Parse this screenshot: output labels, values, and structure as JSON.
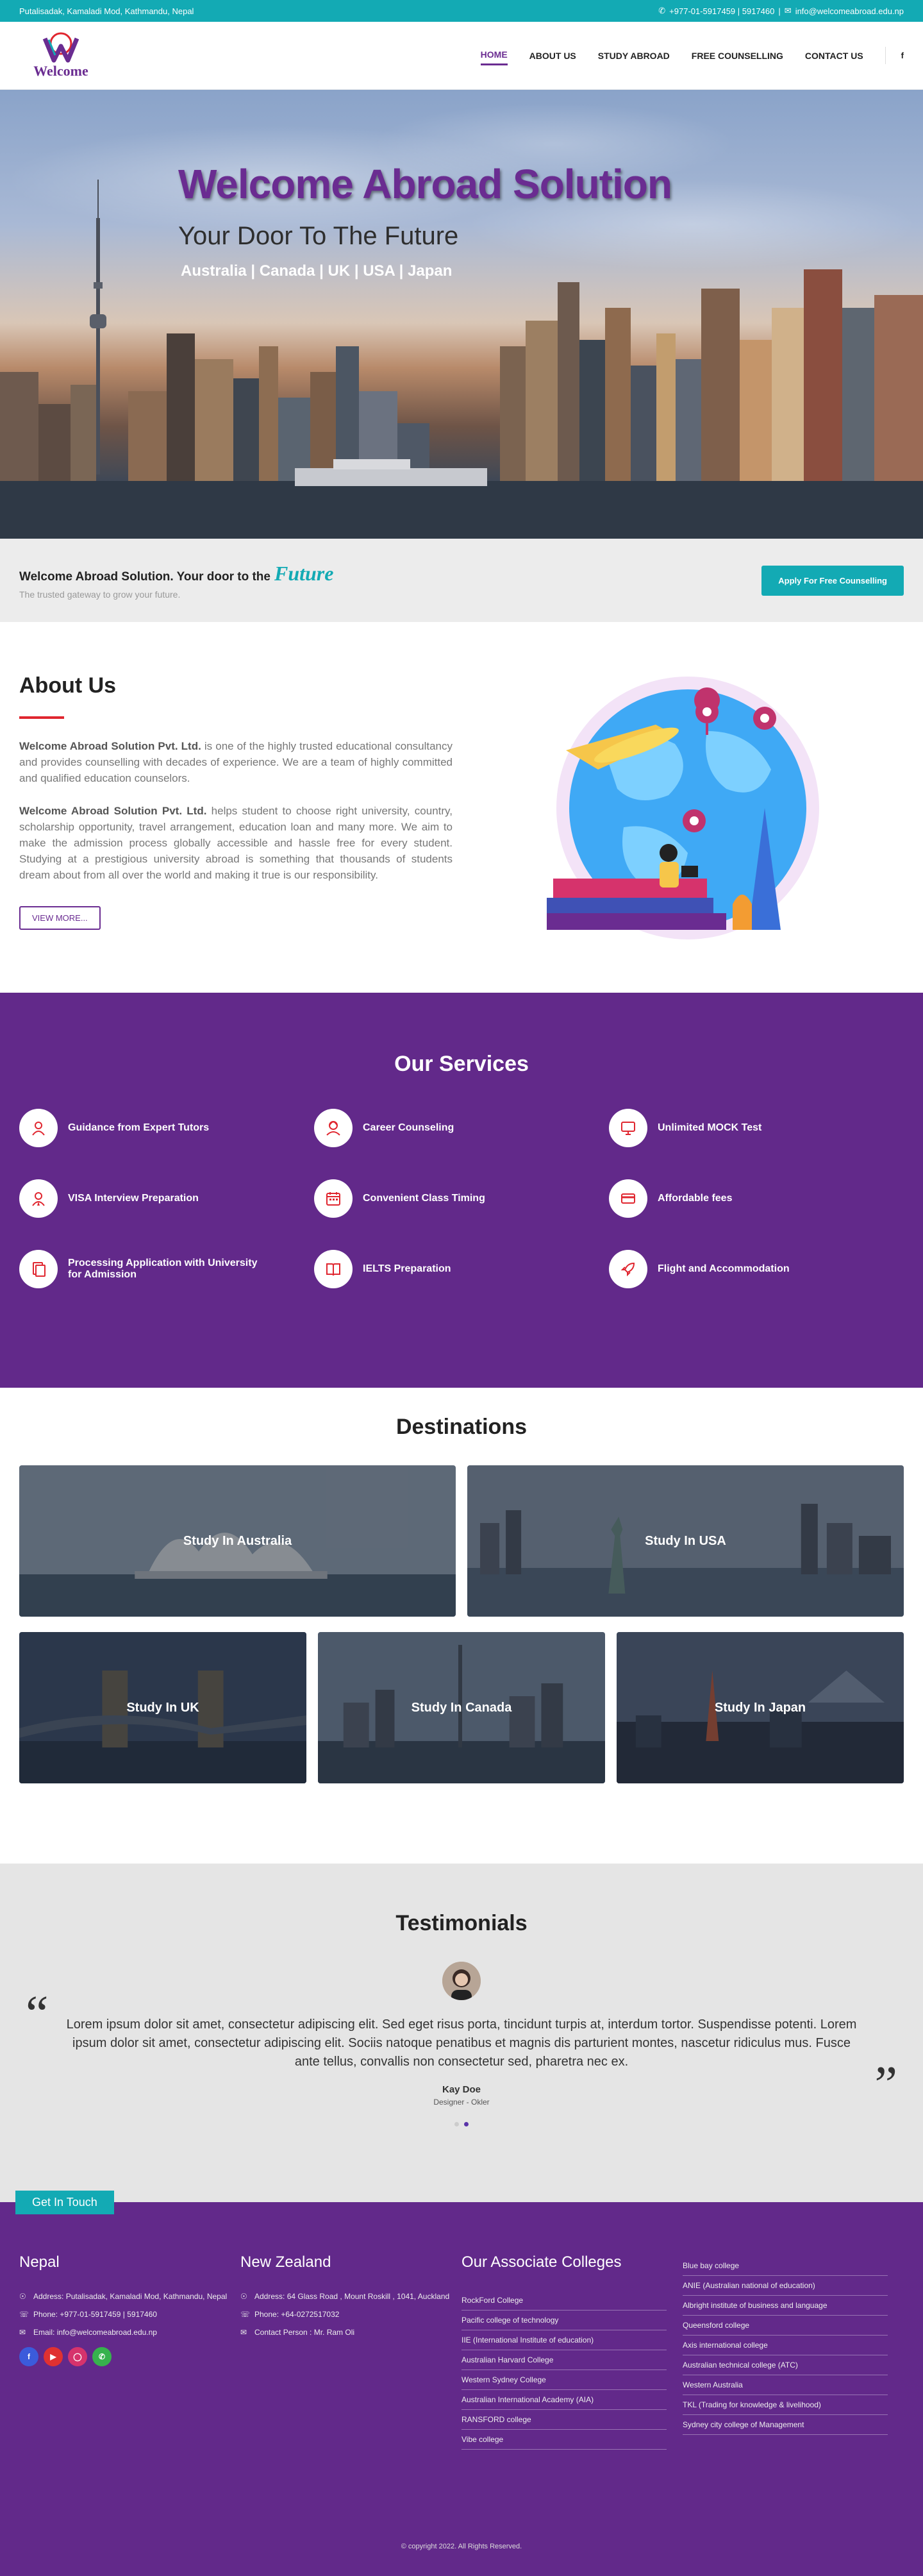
{
  "topbar": {
    "address": "Putalisadak, Kamaladi Mod, Kathmandu, Nepal",
    "phone": "+977-01-5917459 | 5917460",
    "separator": "|",
    "email": "info@welcomeabroad.edu.np"
  },
  "logo": {
    "text": "Welcome"
  },
  "nav": {
    "items": [
      "HOME",
      "ABOUT US",
      "STUDY ABROAD",
      "FREE COUNSELLING",
      "CONTACT US"
    ],
    "active": "HOME",
    "social": "f"
  },
  "hero": {
    "title": "Welcome Abroad Solution",
    "subtitle": "Your Door To The Future",
    "countries": "Australia | Canada | UK | USA | Japan"
  },
  "cta": {
    "title": "Welcome Abroad Solution. Your door to the",
    "future": "Future",
    "subtitle": "The trusted gateway to grow your future.",
    "button": "Apply For Free Counselling"
  },
  "about": {
    "heading": "About Us",
    "p1_bold": "Welcome Abroad Solution Pvt. Ltd.",
    "p1": " is one of the highly trusted educational consultancy and provides counselling with decades of experience. We are a team of highly committed and qualified education counselors.",
    "p2_bold": "Welcome Abroad Solution Pvt. Ltd.",
    "p2": " helps student to choose right university, country, scholarship opportunity, travel arrangement, education loan and many more. We aim to make the admission process globally accessible and hassle free for every student. Studying at a prestigious university abroad is something that thousands of students dream about from all over the world and making it true is our responsibility.",
    "button": "VIEW MORE..."
  },
  "services": {
    "heading": "Our Services",
    "items": [
      {
        "label": "Guidance from Expert Tutors",
        "icon": "tutor-icon"
      },
      {
        "label": "Career Counseling",
        "icon": "counselor-icon"
      },
      {
        "label": "Unlimited MOCK Test",
        "icon": "monitor-icon"
      },
      {
        "label": "VISA Interview Preparation",
        "icon": "interview-icon"
      },
      {
        "label": "Convenient Class Timing",
        "icon": "calendar-icon"
      },
      {
        "label": "Affordable fees",
        "icon": "card-icon"
      },
      {
        "label": "Processing Application with University for Admission",
        "icon": "document-icon"
      },
      {
        "label": "IELTS Preparation",
        "icon": "book-icon"
      },
      {
        "label": "Flight and Accommodation",
        "icon": "rocket-icon"
      }
    ],
    "accent": "#e0262f"
  },
  "destinations": {
    "heading": "Destinations",
    "cards": [
      "Study In Australia",
      "Study In USA",
      "Study In UK",
      "Study In Canada",
      "Study In Japan"
    ]
  },
  "testimonials": {
    "heading": "Testimonials",
    "open_quote": "“",
    "close_quote": "”",
    "text": "Lorem ipsum dolor sit amet, consectetur adipiscing elit. Sed eget risus porta, tincidunt turpis at, interdum tortor. Suspendisse potenti. Lorem ipsum dolor sit amet, consectetur adipiscing elit. Sociis natoque penatibus et magnis dis parturient montes, nascetur ridiculus mus. Fusce ante tellus, convallis non consectetur sed, pharetra nec ex.",
    "name": "Kay Doe",
    "role": "Designer - Okler"
  },
  "footer": {
    "tab": "Get In Touch",
    "nepal": {
      "heading": "Nepal",
      "address": "Address: Putalisadak, Kamaladi Mod, Kathmandu, Nepal",
      "phone": "Phone: +977-01-5917459 | 5917460",
      "email_label": "Email: ",
      "email": "info@welcomeabroad.edu.np"
    },
    "nz": {
      "heading": "New Zealand",
      "address": "Address: 64 Glass Road , Mount Roskill , 1041, Auckland",
      "phone": "Phone: +64-0272517032",
      "contact": "Contact Person : Mr. Ram Oli"
    },
    "colleges_heading": "Our Associate Colleges",
    "colleges1": [
      "RockFord College",
      "Pacific college of technology",
      "IIE (International Institute of education)",
      "Australian Harvard College",
      "Western Sydney College",
      "Australian International Academy (AIA)",
      "RANSFORD college",
      "Vibe college"
    ],
    "colleges2": [
      "Blue bay college",
      "ANIE (Australian national of education)",
      "Albright institute of business and language",
      "Queensford college",
      "Axis international college",
      "Australian technical college (ATC)",
      "Western Australia",
      "TKL (Trading for knowledge & livelihood)",
      "Sydney city college of Management"
    ],
    "copyright": "© copyright 2022. All Rights Reserved."
  },
  "colors": {
    "primary": "#6a2c91",
    "teal": "#13aab4",
    "red": "#e0262f",
    "footer": "#62298a"
  }
}
